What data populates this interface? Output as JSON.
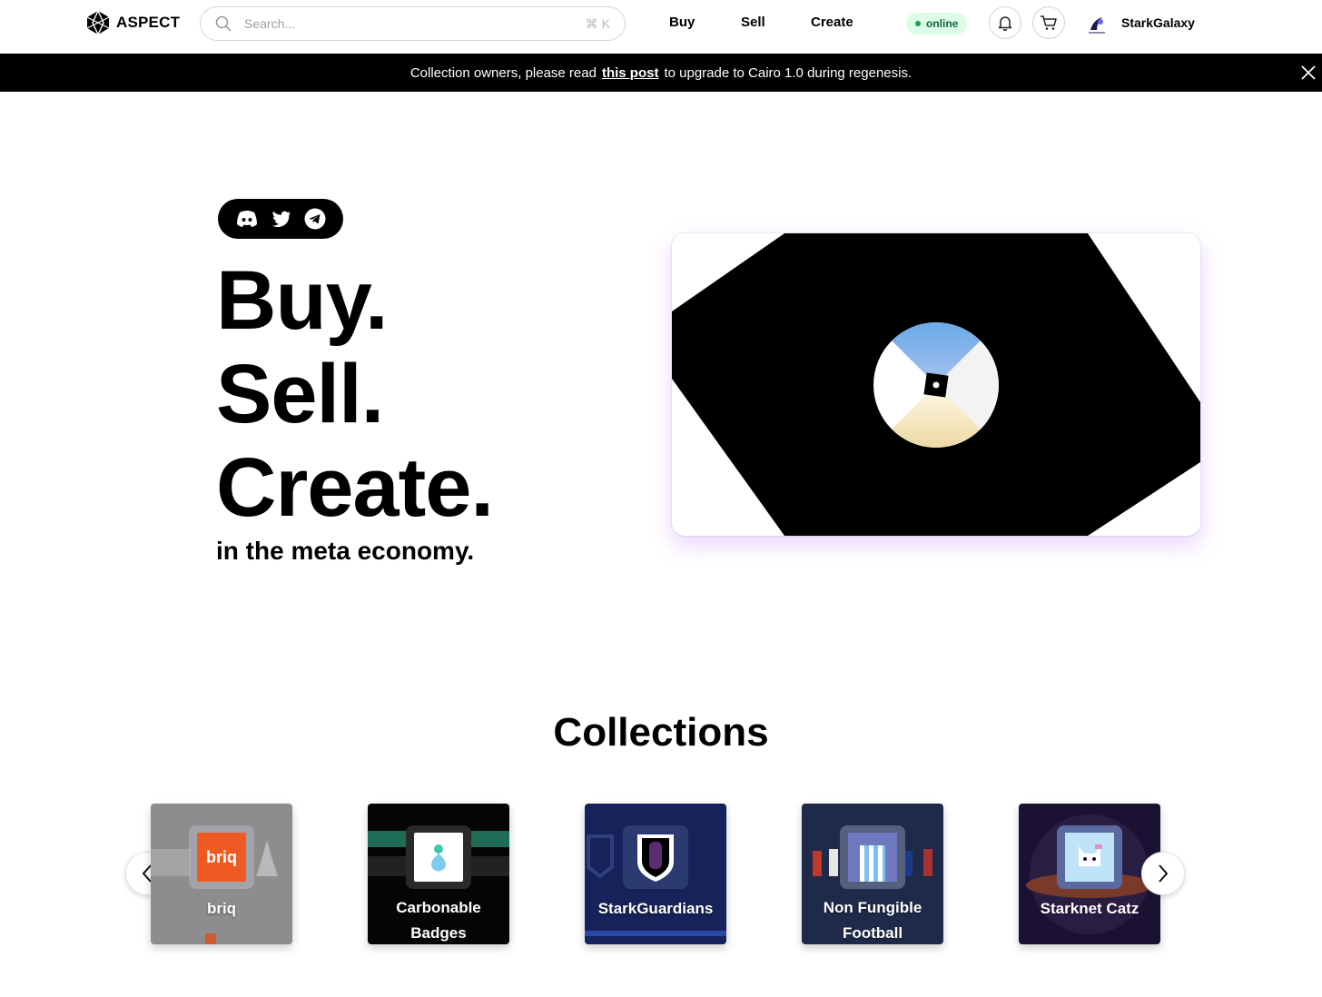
{
  "header": {
    "logo_text": "ASPECT",
    "search": {
      "placeholder": "Search...",
      "shortcut": "⌘ K"
    },
    "nav": {
      "buy": "Buy",
      "sell": "Sell",
      "create": "Create"
    },
    "status": "online",
    "username": "StarkGalaxy"
  },
  "banner": {
    "before": "Collection owners, please read",
    "link": "this post",
    "after": "to upgrade to Cairo 1.0 during regenesis."
  },
  "hero": {
    "line1": "Buy.",
    "line2": "Sell.",
    "line3": "Create.",
    "subtitle": "in the meta economy."
  },
  "collections": {
    "title": "Collections",
    "items": [
      {
        "name": "briq",
        "thumb_text": "briq"
      },
      {
        "name_line1": "Carbonable",
        "name_line2": "Badges"
      },
      {
        "name": "StarkGuardians"
      },
      {
        "name_line1": "Non Fungible",
        "name_line2": "Football"
      },
      {
        "name": "Starknet Catz"
      }
    ]
  },
  "colors": {
    "status_bg": "#dcfce7",
    "status_text": "#166534",
    "briq_orange": "#f05a22",
    "carbonable_teal": "#3ec7a9",
    "guardians_blue": "#16235a",
    "football_navy": "#1f2a4a",
    "catz_purple": "#1b1133"
  }
}
